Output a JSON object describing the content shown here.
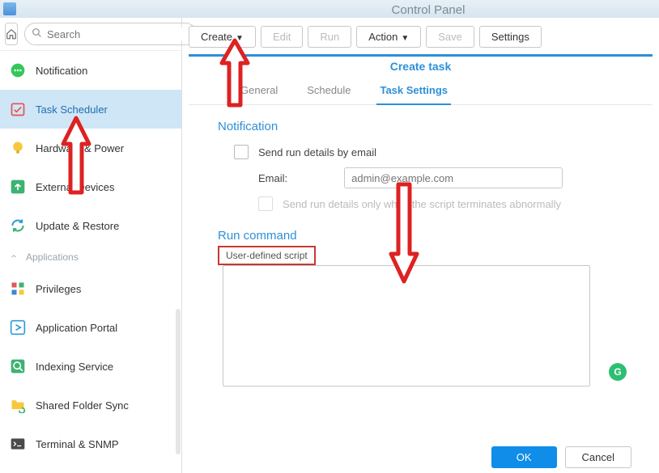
{
  "app": {
    "title": "Control Panel"
  },
  "search": {
    "placeholder": "Search"
  },
  "sidebar": {
    "items": [
      {
        "label": "Notification"
      },
      {
        "label": "Task Scheduler"
      },
      {
        "label": "Hardware & Power"
      },
      {
        "label": "External Devices"
      },
      {
        "label": "Update & Restore"
      }
    ],
    "group_label": "Applications",
    "app_items": [
      {
        "label": "Privileges"
      },
      {
        "label": "Application Portal"
      },
      {
        "label": "Indexing Service"
      },
      {
        "label": "Shared Folder Sync"
      },
      {
        "label": "Terminal & SNMP"
      }
    ]
  },
  "toolbar": {
    "create": "Create",
    "edit": "Edit",
    "run": "Run",
    "action": "Action",
    "save": "Save",
    "settings": "Settings"
  },
  "modal": {
    "title": "Create task",
    "tabs": {
      "general": "General",
      "schedule": "Schedule",
      "task_settings": "Task Settings"
    },
    "notification": {
      "heading": "Notification",
      "send_label": "Send run details by email",
      "email_label": "Email:",
      "email_placeholder": "admin@example.com",
      "abnormal_label": "Send run details only when the script terminates abnormally"
    },
    "run_command": {
      "heading": "Run command",
      "script_label": "User-defined script",
      "script_value": ""
    },
    "ok": "OK",
    "cancel": "Cancel"
  }
}
